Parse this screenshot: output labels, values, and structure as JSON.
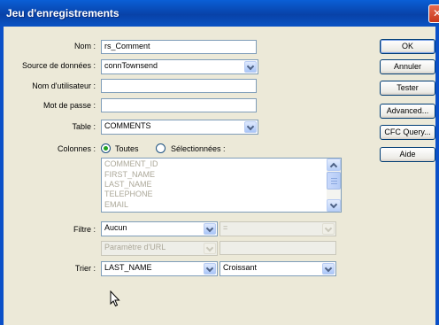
{
  "window": {
    "title": "Jeu d'enregistrements"
  },
  "form": {
    "nom_label": "Nom :",
    "nom_value": "rs_Comment",
    "source_label": "Source de données :",
    "source_value": "connTownsend",
    "user_label": "Nom d'utilisateur :",
    "user_value": "",
    "password_label": "Mot de passe :",
    "password_value": "",
    "table_label": "Table :",
    "table_value": "COMMENTS",
    "columns_label": "Colonnes :",
    "columns_all_label": "Toutes",
    "columns_selected_label": "Sélectionnées :",
    "columns_list": [
      "COMMENT_ID",
      "FIRST_NAME",
      "LAST_NAME",
      "TELEPHONE",
      "EMAIL"
    ],
    "filter_label": "Filtre :",
    "filter_value": "Aucun",
    "filter_operator": "=",
    "filter_param_type": "Paramètre d'URL",
    "filter_param_value": "",
    "sort_label": "Trier :",
    "sort_value": "LAST_NAME",
    "sort_order": "Croissant"
  },
  "buttons": {
    "ok": "OK",
    "cancel": "Annuler",
    "test": "Tester",
    "advanced": "Advanced...",
    "cfc_query": "CFC Query...",
    "help": "Aide"
  },
  "colors": {
    "titlebar": "#0a53c4",
    "dialog_bg": "#ece9d8",
    "input_border": "#7f9db9",
    "disabled_text": "#aca899",
    "radio_selected": "#21a121"
  }
}
